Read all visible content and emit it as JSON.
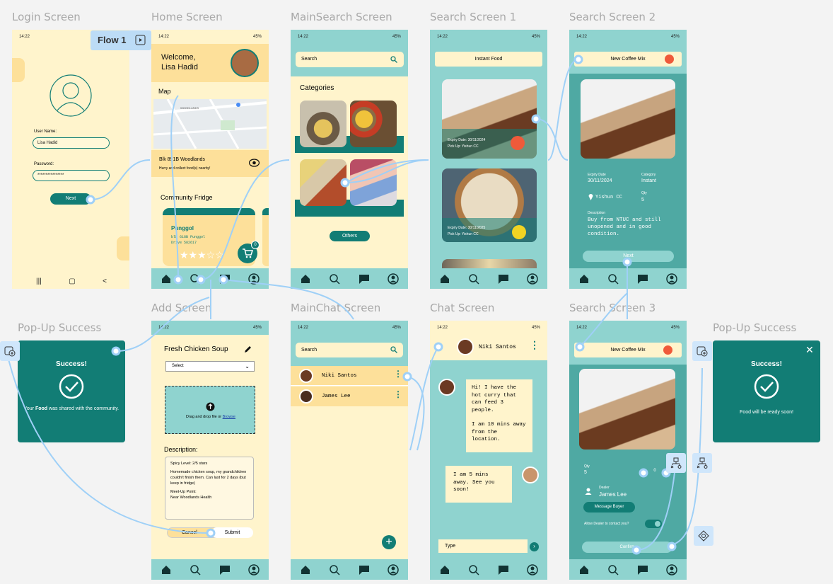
{
  "labels": {
    "login": "Login Screen",
    "home": "Home Screen",
    "mainsearch": "MainSearch Screen",
    "search1": "Search Screen 1",
    "search2": "Search Screen 2",
    "add": "Add Screen",
    "mainchat": "MainChat Screen",
    "chat": "Chat Screen",
    "search3": "Search Screen 3",
    "popup_left": "Pop-Up Success",
    "popup_right": "Pop-Up Success",
    "flow": "Flow 1"
  },
  "status": {
    "time": "14:22",
    "battery": "45%"
  },
  "login": {
    "username_label": "User Name:",
    "username_value": "Lisa Hadid",
    "password_label": "Password:",
    "password_value": "****************",
    "next": "Next"
  },
  "home": {
    "welcome": "Welcome,",
    "name": "Lisa Hadid",
    "map_label": "Map",
    "map_place": "WOODLANDS",
    "address": "Blk 891B Woodlands",
    "address_sub": "Hurry and collect food(s) nearby!",
    "community": "Community Fridge",
    "fridge_name": "Punggol",
    "fridge_addr1": "blk 618B Punggol",
    "fridge_addr2": "Drive 582617",
    "cart_count": "0"
  },
  "mainsearch": {
    "search_placeholder": "Search",
    "categories": "Categories",
    "others": "Others"
  },
  "search1": {
    "title": "Instant Food",
    "item1_expiry": "Expiry Date: 30/11/2024",
    "item1_pickup": "Pick Up: Yishun CC",
    "item2_expiry": "Expiry Date: 30/11/2025",
    "item2_pickup": "Pick Up: Yishun CC"
  },
  "search2": {
    "title": "New Coffee Mix",
    "expiry_label": "Expiry Date",
    "expiry_value": "30/11/2024",
    "category_label": "Category",
    "category_value": "Instant",
    "location": "Yishun CC",
    "qty_label": "Qty",
    "qty_value": "5",
    "desc_label": "Description",
    "desc_value": "Buy from NTUC and still unopened and in good condition.",
    "next": "Next"
  },
  "add": {
    "title": "Fresh Chicken Soup",
    "select": "Select",
    "drop_text": "Drag and drop file or",
    "browse": "Browse",
    "desc_label": "Description:",
    "spicy": "Spicy Level: 2/5 stars",
    "desc_body": "Homemade chicken soup, my grandchildren couldn't finish them. Can last for 2 days (but keep in fridge)",
    "meet_label": "Meet-Up Point:",
    "meet_value": "Near Woodlands Health",
    "cancel": "Cancel",
    "submit": "Submit"
  },
  "mainchat": {
    "search_placeholder": "Search",
    "contacts": [
      "Niki Santos",
      "James Lee"
    ]
  },
  "chat": {
    "contact": "Niki Santos",
    "msg1": "Hi! I have the hot curry that can feed 3 people.",
    "msg1b": "I am 10 mins away from the location.",
    "msg2": "I am 5 mins away. See you soon!",
    "type_placeholder": "Type"
  },
  "search3": {
    "title": "New Coffee Mix",
    "qty_label": "Qty",
    "qty_value": "5",
    "stepper_value": "0",
    "dealer_label": "Dealer",
    "dealer_name": "James Lee",
    "message": "Message Buyer",
    "allow": "Allow Dealer to contact you?",
    "confirm": "Confirm"
  },
  "popup_left": {
    "title": "Success!",
    "text_pre": "Your",
    "text_bold": "Food",
    "text_post": "was shared with the community."
  },
  "popup_right": {
    "title": "Success!",
    "text": "Food will be ready soon!"
  },
  "colors": {
    "teal": "#127d75",
    "mint": "#8fd3cf",
    "cream": "#fff4cc",
    "yellow": "#fde09a",
    "wire": "#9fd0f7"
  }
}
